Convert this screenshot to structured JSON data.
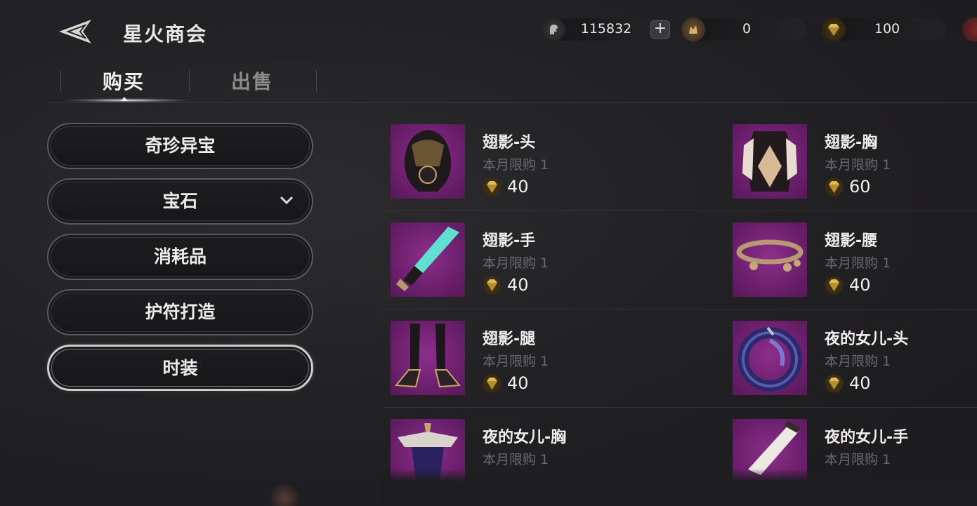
{
  "header": {
    "title": "星火商会",
    "back_icon": "back-arrow-icon"
  },
  "currencies": [
    {
      "icon": "silver-coin-icon",
      "value": "115832",
      "color": "#b9b7b4"
    },
    {
      "icon": "gold-coin-icon",
      "value": "0",
      "color": "#c9a050"
    },
    {
      "icon": "gem-icon",
      "value": "100",
      "color": "#d7b34a"
    }
  ],
  "plus_label": "+",
  "tabs": [
    {
      "label": "购买",
      "active": true
    },
    {
      "label": "出售",
      "active": false
    }
  ],
  "categories": [
    {
      "label": "奇珍异宝"
    },
    {
      "label": "宝石",
      "has_dropdown": true
    },
    {
      "label": "消耗品"
    },
    {
      "label": "护符打造"
    },
    {
      "label": "时装",
      "selected": true
    }
  ],
  "items": [
    {
      "name": "翅影-头",
      "limit": "本月限购 1",
      "price": "40"
    },
    {
      "name": "翅影-胸",
      "limit": "本月限购 1",
      "price": "60"
    },
    {
      "name": "翅影-手",
      "limit": "本月限购 1",
      "price": "40"
    },
    {
      "name": "翅影-腰",
      "limit": "本月限购 1",
      "price": "40"
    },
    {
      "name": "翅影-腿",
      "limit": "本月限购 1",
      "price": "40"
    },
    {
      "name": "夜的女儿-头",
      "limit": "本月限购 1",
      "price": "40"
    },
    {
      "name": "夜的女儿-胸",
      "limit": "本月限购 1",
      "price": ""
    },
    {
      "name": "夜的女儿-手",
      "limit": "本月限购 1",
      "price": ""
    }
  ],
  "colors": {
    "background": "#222124",
    "thumb_purple": "#6c1f6d",
    "muted_text": "#6c6a6b",
    "gem_gold": "#d7b34a"
  }
}
